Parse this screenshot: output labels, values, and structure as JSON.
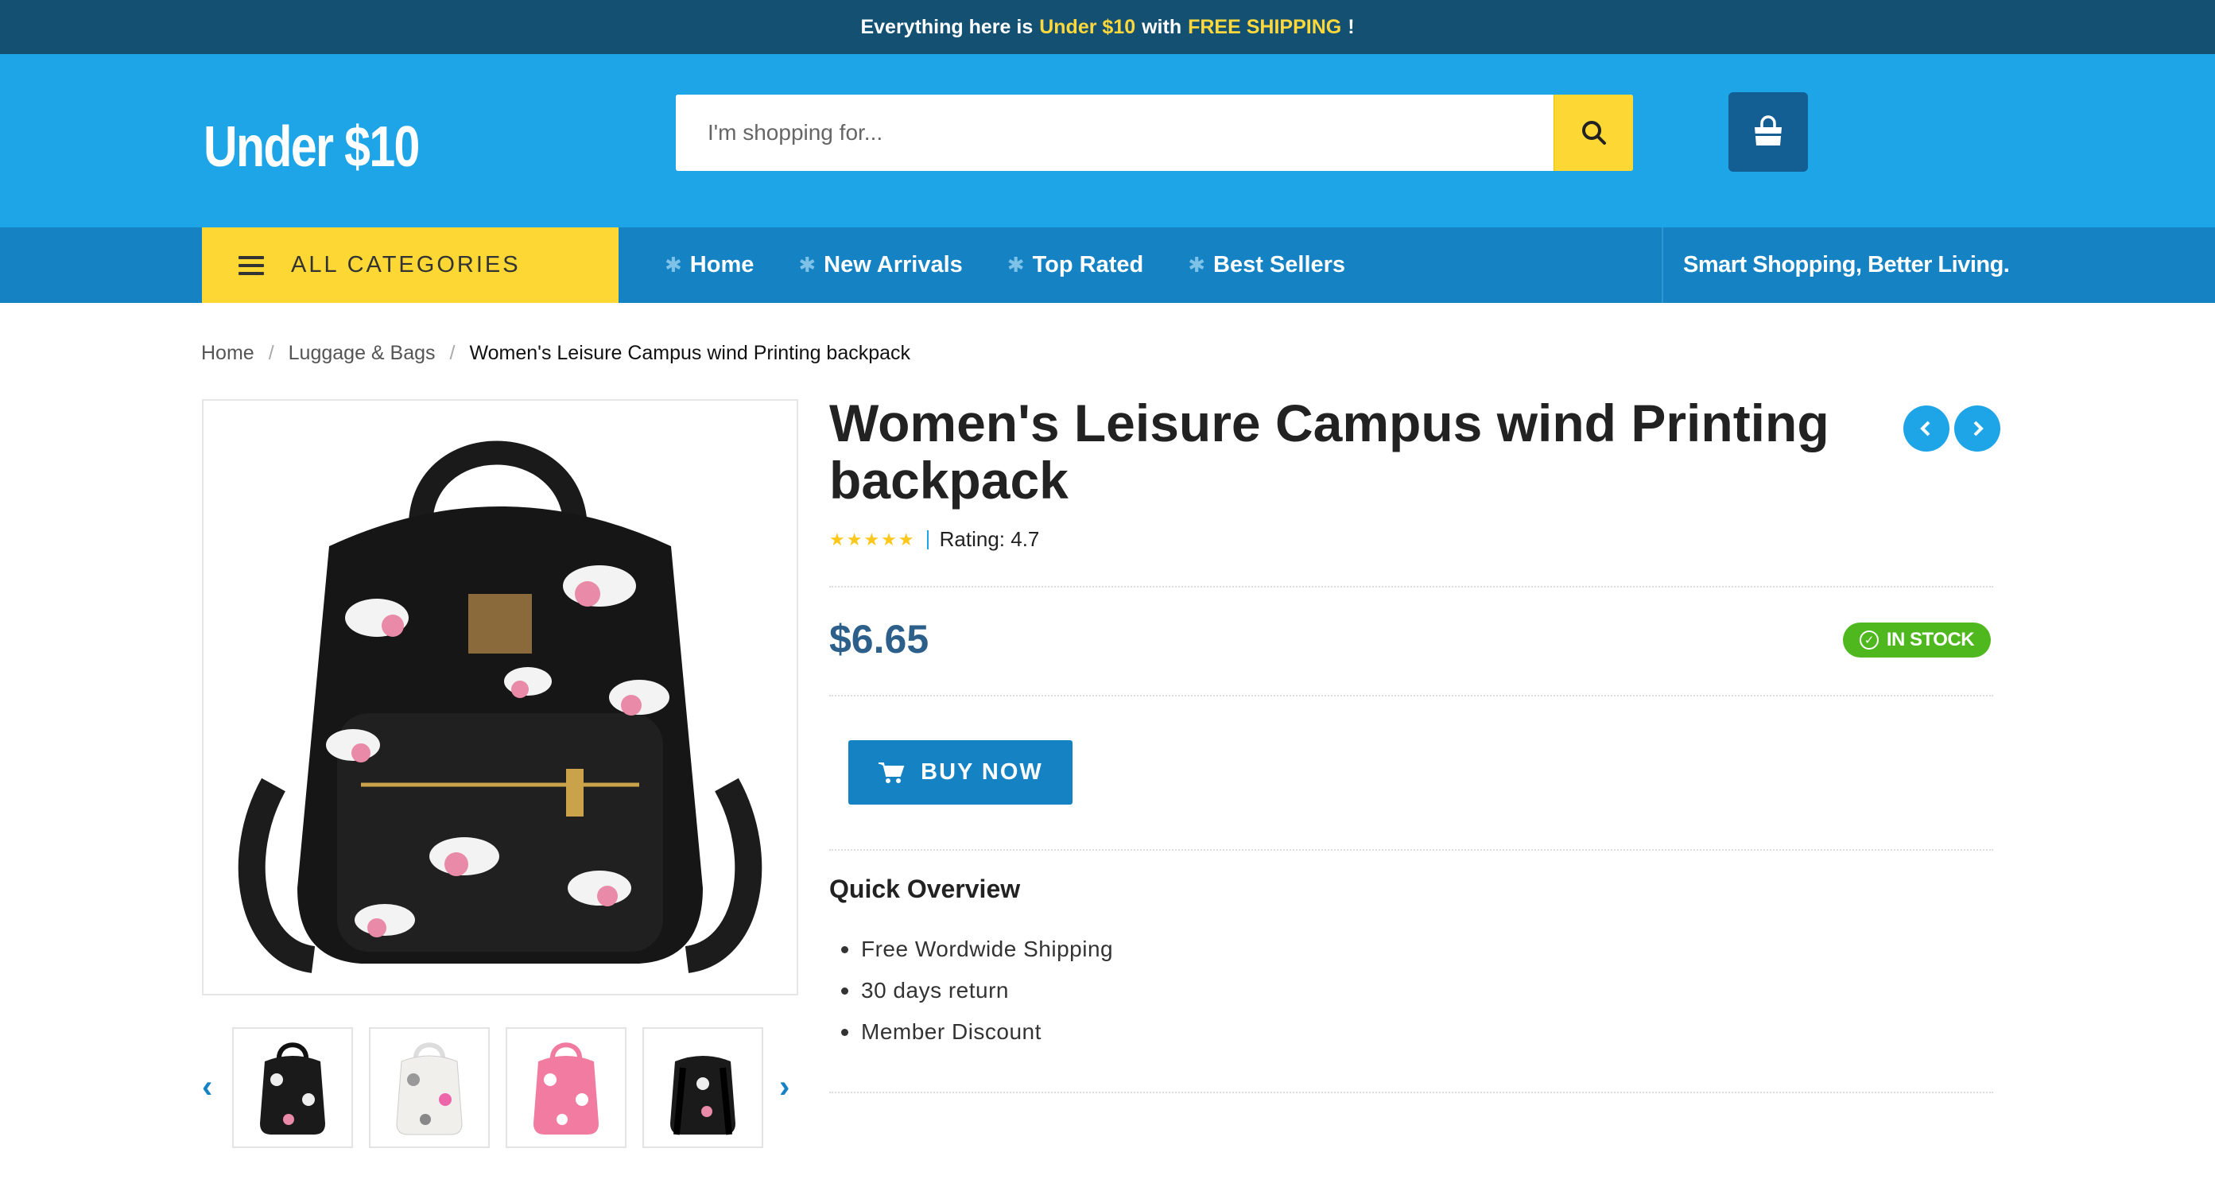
{
  "announcement": {
    "prefix": "Everything here is",
    "highlight1": "Under $10",
    "middle": "with",
    "highlight2": "FREE SHIPPING",
    "suffix": "!"
  },
  "header": {
    "logo": "Under $10",
    "search_placeholder": "I'm shopping for...",
    "search_icon": "search-icon",
    "cart_icon": "shopping-bag-icon"
  },
  "nav": {
    "all_categories": "ALL CATEGORIES",
    "links": [
      "Home",
      "New Arrivals",
      "Top Rated",
      "Best Sellers"
    ],
    "slogan": "Smart Shopping, Better Living."
  },
  "breadcrumb": [
    "Home",
    "Luggage & Bags",
    "Women's Leisure Campus wind Printing backpack"
  ],
  "product": {
    "title": "Women's Leisure Campus wind Printing backpack",
    "rating_text": "Rating: 4.7",
    "stars": "★★★★★",
    "price": "$6.65",
    "stock": "IN STOCK",
    "buy_label": "BUY NOW",
    "overview_title": "Quick Overview",
    "overview_items": [
      "Free Wordwide Shipping",
      "30 days return",
      "Member Discount"
    ]
  },
  "colors": {
    "topbar": "#135072",
    "header": "#1da5e7",
    "nav": "#1582c4",
    "accent_yellow": "#fdd835",
    "stock_green": "#4fb81e",
    "price": "#2c5f8a"
  }
}
